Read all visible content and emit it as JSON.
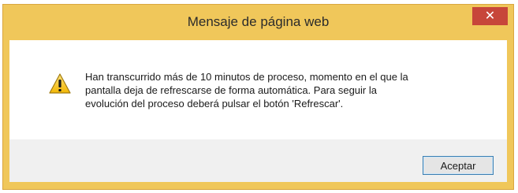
{
  "dialog": {
    "title": "Mensaje de página web",
    "close_symbol": "✕",
    "icon": "warning-icon",
    "message_lines": [
      "Han transcurrido más de 10 minutos de proceso, momento en el que la",
      "pantalla deja de refrescarse de forma automática. Para seguir la",
      "evolución del proceso deberá pulsar el botón 'Refrescar'."
    ],
    "ok_label": "Aceptar"
  },
  "colors": {
    "frame": "#f0c75a",
    "close_button": "#c7463a",
    "footer": "#f0f0f0",
    "ok_border": "#3c7fb1"
  }
}
